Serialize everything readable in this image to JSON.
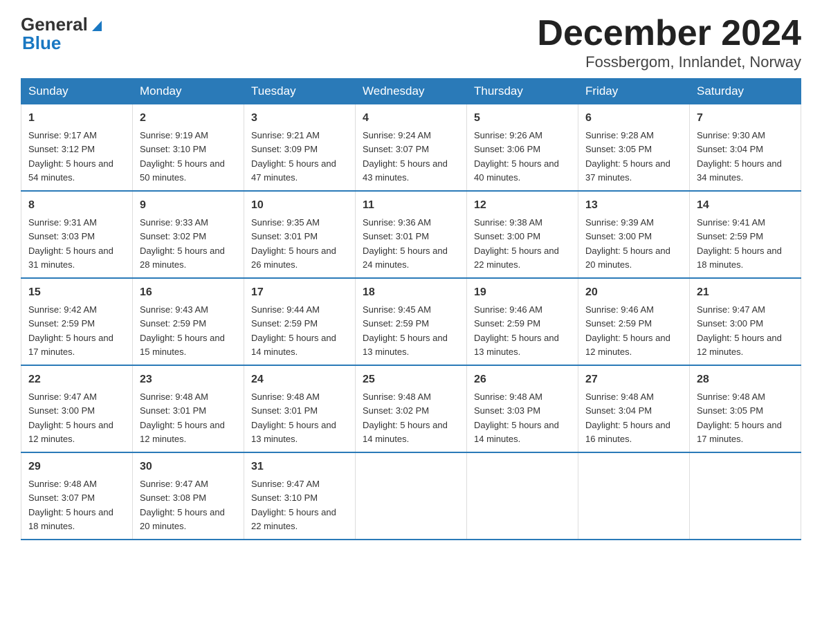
{
  "header": {
    "logo_general": "General",
    "logo_blue": "Blue",
    "month_title": "December 2024",
    "location": "Fossbergom, Innlandet, Norway"
  },
  "weekdays": [
    "Sunday",
    "Monday",
    "Tuesday",
    "Wednesday",
    "Thursday",
    "Friday",
    "Saturday"
  ],
  "weeks": [
    [
      {
        "day": "1",
        "sunrise": "9:17 AM",
        "sunset": "3:12 PM",
        "daylight": "5 hours and 54 minutes."
      },
      {
        "day": "2",
        "sunrise": "9:19 AM",
        "sunset": "3:10 PM",
        "daylight": "5 hours and 50 minutes."
      },
      {
        "day": "3",
        "sunrise": "9:21 AM",
        "sunset": "3:09 PM",
        "daylight": "5 hours and 47 minutes."
      },
      {
        "day": "4",
        "sunrise": "9:24 AM",
        "sunset": "3:07 PM",
        "daylight": "5 hours and 43 minutes."
      },
      {
        "day": "5",
        "sunrise": "9:26 AM",
        "sunset": "3:06 PM",
        "daylight": "5 hours and 40 minutes."
      },
      {
        "day": "6",
        "sunrise": "9:28 AM",
        "sunset": "3:05 PM",
        "daylight": "5 hours and 37 minutes."
      },
      {
        "day": "7",
        "sunrise": "9:30 AM",
        "sunset": "3:04 PM",
        "daylight": "5 hours and 34 minutes."
      }
    ],
    [
      {
        "day": "8",
        "sunrise": "9:31 AM",
        "sunset": "3:03 PM",
        "daylight": "5 hours and 31 minutes."
      },
      {
        "day": "9",
        "sunrise": "9:33 AM",
        "sunset": "3:02 PM",
        "daylight": "5 hours and 28 minutes."
      },
      {
        "day": "10",
        "sunrise": "9:35 AM",
        "sunset": "3:01 PM",
        "daylight": "5 hours and 26 minutes."
      },
      {
        "day": "11",
        "sunrise": "9:36 AM",
        "sunset": "3:01 PM",
        "daylight": "5 hours and 24 minutes."
      },
      {
        "day": "12",
        "sunrise": "9:38 AM",
        "sunset": "3:00 PM",
        "daylight": "5 hours and 22 minutes."
      },
      {
        "day": "13",
        "sunrise": "9:39 AM",
        "sunset": "3:00 PM",
        "daylight": "5 hours and 20 minutes."
      },
      {
        "day": "14",
        "sunrise": "9:41 AM",
        "sunset": "2:59 PM",
        "daylight": "5 hours and 18 minutes."
      }
    ],
    [
      {
        "day": "15",
        "sunrise": "9:42 AM",
        "sunset": "2:59 PM",
        "daylight": "5 hours and 17 minutes."
      },
      {
        "day": "16",
        "sunrise": "9:43 AM",
        "sunset": "2:59 PM",
        "daylight": "5 hours and 15 minutes."
      },
      {
        "day": "17",
        "sunrise": "9:44 AM",
        "sunset": "2:59 PM",
        "daylight": "5 hours and 14 minutes."
      },
      {
        "day": "18",
        "sunrise": "9:45 AM",
        "sunset": "2:59 PM",
        "daylight": "5 hours and 13 minutes."
      },
      {
        "day": "19",
        "sunrise": "9:46 AM",
        "sunset": "2:59 PM",
        "daylight": "5 hours and 13 minutes."
      },
      {
        "day": "20",
        "sunrise": "9:46 AM",
        "sunset": "2:59 PM",
        "daylight": "5 hours and 12 minutes."
      },
      {
        "day": "21",
        "sunrise": "9:47 AM",
        "sunset": "3:00 PM",
        "daylight": "5 hours and 12 minutes."
      }
    ],
    [
      {
        "day": "22",
        "sunrise": "9:47 AM",
        "sunset": "3:00 PM",
        "daylight": "5 hours and 12 minutes."
      },
      {
        "day": "23",
        "sunrise": "9:48 AM",
        "sunset": "3:01 PM",
        "daylight": "5 hours and 12 minutes."
      },
      {
        "day": "24",
        "sunrise": "9:48 AM",
        "sunset": "3:01 PM",
        "daylight": "5 hours and 13 minutes."
      },
      {
        "day": "25",
        "sunrise": "9:48 AM",
        "sunset": "3:02 PM",
        "daylight": "5 hours and 14 minutes."
      },
      {
        "day": "26",
        "sunrise": "9:48 AM",
        "sunset": "3:03 PM",
        "daylight": "5 hours and 14 minutes."
      },
      {
        "day": "27",
        "sunrise": "9:48 AM",
        "sunset": "3:04 PM",
        "daylight": "5 hours and 16 minutes."
      },
      {
        "day": "28",
        "sunrise": "9:48 AM",
        "sunset": "3:05 PM",
        "daylight": "5 hours and 17 minutes."
      }
    ],
    [
      {
        "day": "29",
        "sunrise": "9:48 AM",
        "sunset": "3:07 PM",
        "daylight": "5 hours and 18 minutes."
      },
      {
        "day": "30",
        "sunrise": "9:47 AM",
        "sunset": "3:08 PM",
        "daylight": "5 hours and 20 minutes."
      },
      {
        "day": "31",
        "sunrise": "9:47 AM",
        "sunset": "3:10 PM",
        "daylight": "5 hours and 22 minutes."
      },
      null,
      null,
      null,
      null
    ]
  ]
}
